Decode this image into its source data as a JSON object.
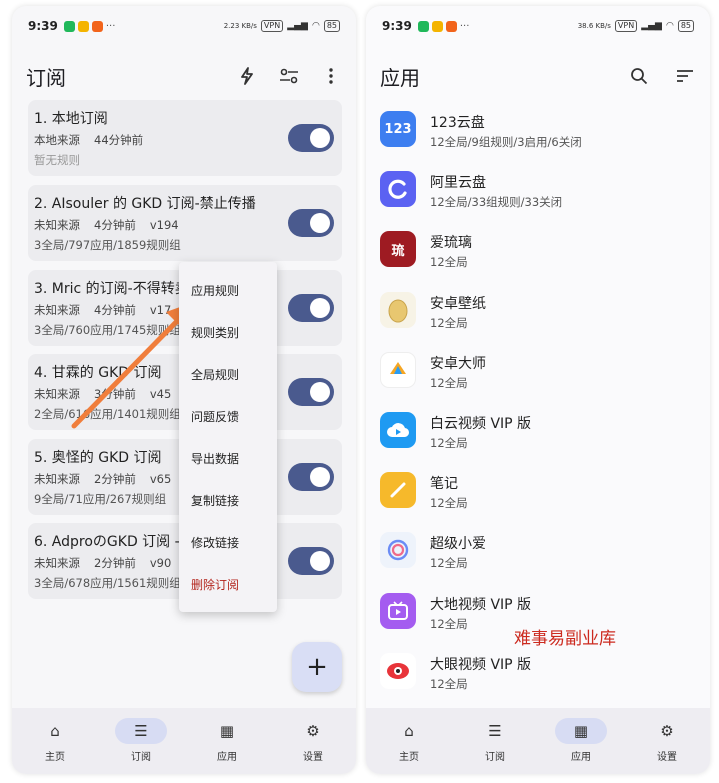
{
  "left": {
    "status": {
      "time": "9:39",
      "net": "2.23 KB/s",
      "vpn": "VPN",
      "battery": "85"
    },
    "title": "订阅",
    "icons": [
      "bolt-icon",
      "filter-settings-icon",
      "more-vert-icon"
    ],
    "subscriptions": [
      {
        "title": "1. 本地订阅",
        "source": "本地来源",
        "time": "44分钟前",
        "version": "",
        "stats": "暂无规则",
        "muted": true
      },
      {
        "title": "2. AIsouler 的 GKD 订阅-禁止传播",
        "source": "未知来源",
        "time": "4分钟前",
        "version": "v194",
        "stats": "3全局/797应用/1859规则组"
      },
      {
        "title": "3. Mric 的订阅-不得转卖",
        "source": "未知来源",
        "time": "4分钟前",
        "version": "v17",
        "stats": "3全局/760应用/1745规则组"
      },
      {
        "title": "4. 甘霖的 GKD 订阅",
        "source": "未知来源",
        "time": "3分钟前",
        "version": "v45",
        "stats": "2全局/616应用/1401规则组"
      },
      {
        "title": "5. 奥怪的 GKD 订阅",
        "source": "未知来源",
        "time": "2分钟前",
        "version": "v65",
        "stats": "9全局/71应用/267规则组"
      },
      {
        "title": "6. AdproのGKD 订阅 - 仅供学习",
        "source": "未知来源",
        "time": "2分钟前",
        "version": "v90",
        "stats": "3全局/678应用/1561规则组"
      }
    ],
    "menu": [
      "应用规则",
      "规则类别",
      "全局规则",
      "问题反馈",
      "导出数据",
      "复制链接",
      "修改链接",
      "删除订阅"
    ],
    "fab": "+",
    "nav": [
      {
        "label": "主页",
        "icon": "home-icon",
        "glyph": "⌂"
      },
      {
        "label": "订阅",
        "icon": "list-icon",
        "glyph": "☰",
        "active": true
      },
      {
        "label": "应用",
        "icon": "apps-grid-icon",
        "glyph": "▦"
      },
      {
        "label": "设置",
        "icon": "gear-icon",
        "glyph": "⚙"
      }
    ]
  },
  "right": {
    "status": {
      "time": "9:39",
      "net": "38.6 KB/s",
      "vpn": "VPN",
      "battery": "85"
    },
    "title": "应用",
    "icons": [
      "search-icon",
      "sort-icon"
    ],
    "apps": [
      {
        "name": "123云盘",
        "rules": "12全局/9组规则/3启用/6关闭",
        "icon": "123-cloud-icon",
        "glyph": "123",
        "color": "#3d7ef0"
      },
      {
        "name": "阿里云盘",
        "rules": "12全局/33组规则/33关闭",
        "icon": "aliyun-drive-icon",
        "glyph": "◯",
        "color": "#5b62f2"
      },
      {
        "name": "爱琉璃",
        "rules": "12全局",
        "icon": "ailiuli-icon",
        "glyph": "琉",
        "color": "#b31d25"
      },
      {
        "name": "安卓壁纸",
        "rules": "12全局",
        "icon": "egg-wallpaper-icon",
        "glyph": "●",
        "color": "#f1ead0"
      },
      {
        "name": "安卓大师",
        "rules": "12全局",
        "icon": "android-master-icon",
        "glyph": "▲",
        "color": "#ffffff"
      },
      {
        "name": "白云视频 VIP 版",
        "rules": "12全局",
        "icon": "cloud-video-icon",
        "glyph": "▶",
        "color": "#1e9af2"
      },
      {
        "name": "笔记",
        "rules": "12全局",
        "icon": "notes-icon",
        "glyph": "/",
        "color": "#f6b92b"
      },
      {
        "name": "超级小爱",
        "rules": "12全局",
        "icon": "xiaoai-icon",
        "glyph": "◎",
        "color": "#eef3fb"
      },
      {
        "name": "大地视频 VIP 版",
        "rules": "12全局",
        "icon": "tv-video-icon",
        "glyph": "▶",
        "color": "#a45cf0"
      },
      {
        "name": "大眼视频 VIP 版",
        "rules": "12全局",
        "icon": "eye-video-icon",
        "glyph": "◉",
        "color": "#ffffff"
      }
    ],
    "watermark": "难事易副业库",
    "nav": [
      {
        "label": "主页",
        "icon": "home-icon",
        "glyph": "⌂"
      },
      {
        "label": "订阅",
        "icon": "list-icon",
        "glyph": "☰"
      },
      {
        "label": "应用",
        "icon": "apps-grid-icon",
        "glyph": "▦",
        "active": true
      },
      {
        "label": "设置",
        "icon": "gear-icon",
        "glyph": "⚙"
      }
    ]
  },
  "colors": {
    "toggle": "#4a5a8e",
    "nav_active": "#d7dcf3",
    "danger": "#b3261e",
    "watermark": "#cc2a1f"
  }
}
